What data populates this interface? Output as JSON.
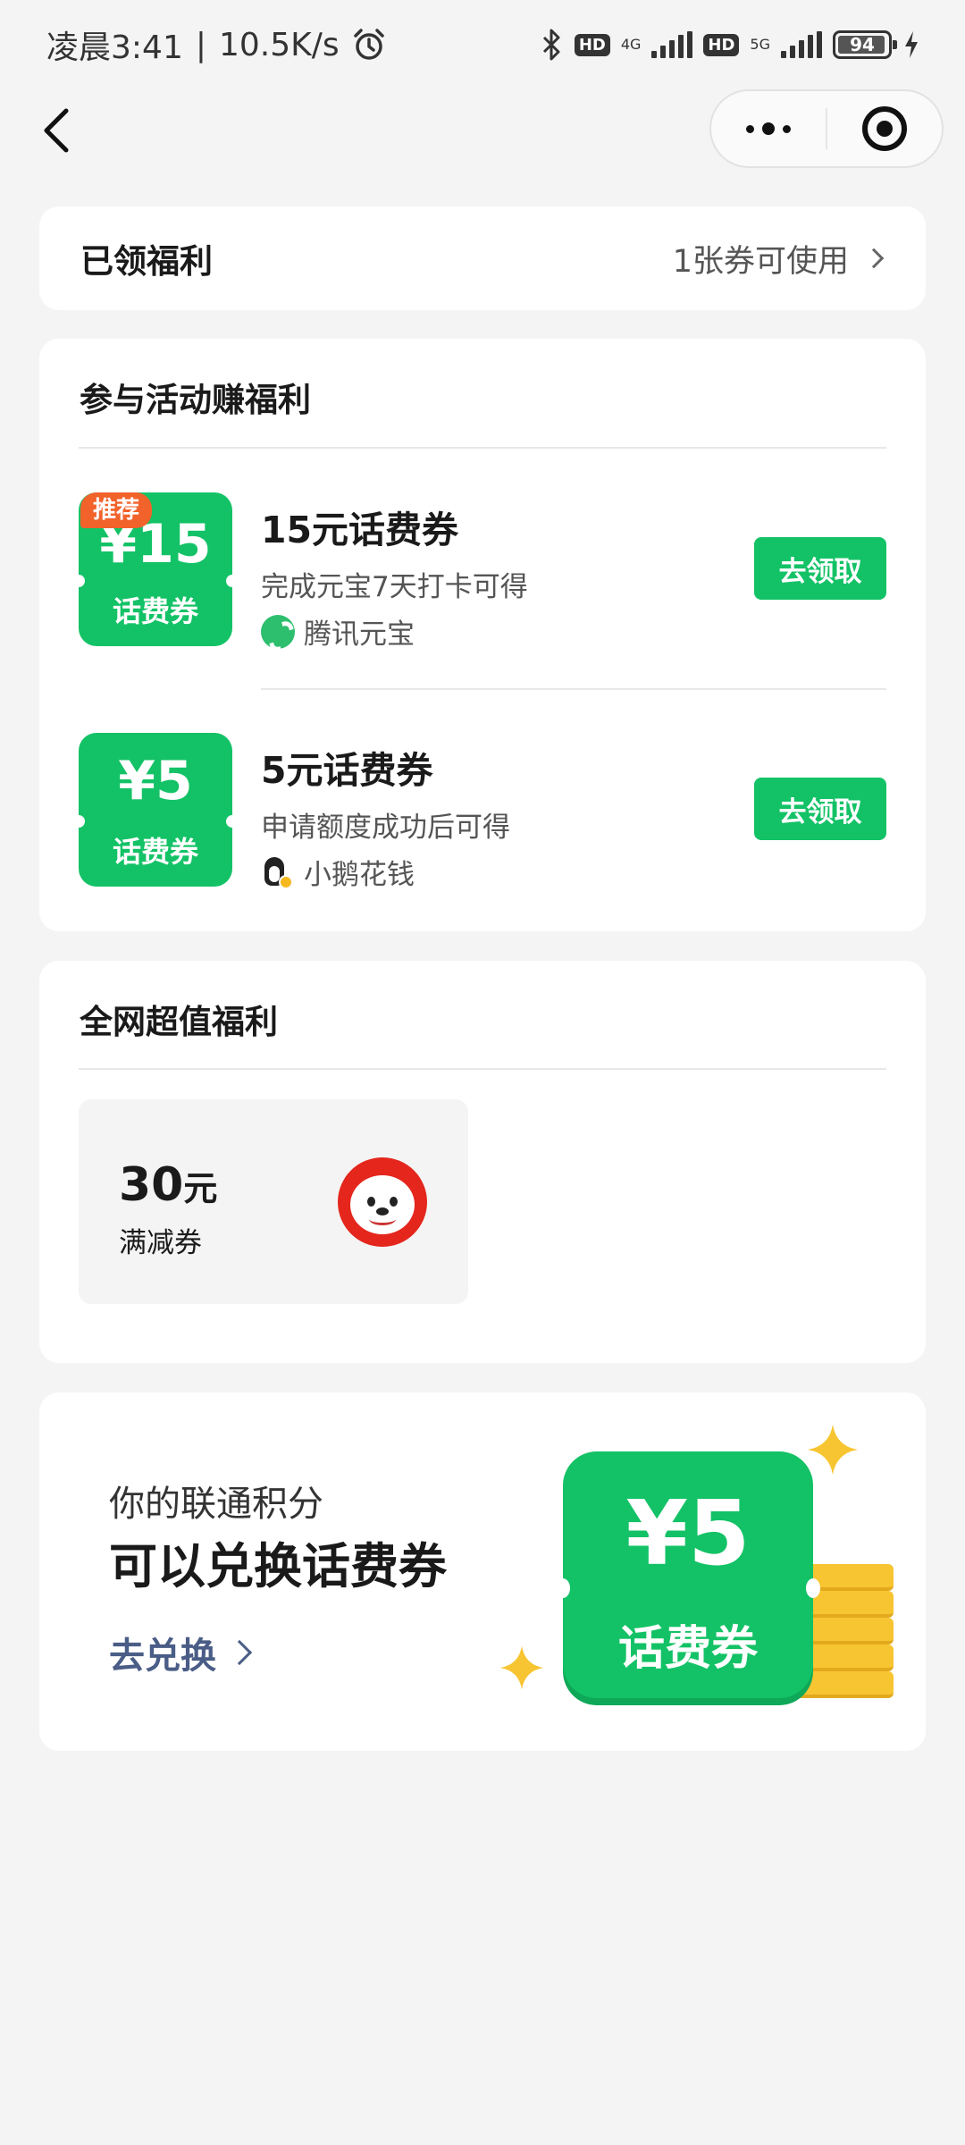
{
  "status_bar": {
    "time": "凌晨3:41",
    "speed": "10.5K/s",
    "hd1": "HD",
    "net1": "4G",
    "hd2": "HD",
    "net2": "5G",
    "battery": "94"
  },
  "nav": {
    "back_icon": "chevron-left-icon",
    "more_icon": "more-dots-icon",
    "close_icon": "target-ring-icon"
  },
  "claimed": {
    "title": "已领福利",
    "summary": "1张券可使用"
  },
  "activity": {
    "title": "参与活动赚福利",
    "items": [
      {
        "tag": "推荐",
        "amount": "¥15",
        "coupon_label": "话费券",
        "name": "15元话费券",
        "desc": "完成元宝7天打卡可得",
        "source": "腾讯元宝",
        "button": "去领取"
      },
      {
        "amount": "¥5",
        "coupon_label": "话费券",
        "name": "5元话费券",
        "desc": "申请额度成功后可得",
        "source": "小鹅花钱",
        "button": "去领取"
      }
    ]
  },
  "deals": {
    "title": "全网超值福利",
    "tile": {
      "amount": "30",
      "unit": "元",
      "label": "满减券"
    }
  },
  "exchange": {
    "subtitle": "你的联通积分",
    "title": "可以兑换话费券",
    "link": "去兑换",
    "coupon_amount": "¥5",
    "coupon_label": "话费券"
  },
  "colors": {
    "green": "#13c266",
    "orange_tag": "#f2622b",
    "link": "#4a5d86",
    "background": "#f4f4f4"
  }
}
